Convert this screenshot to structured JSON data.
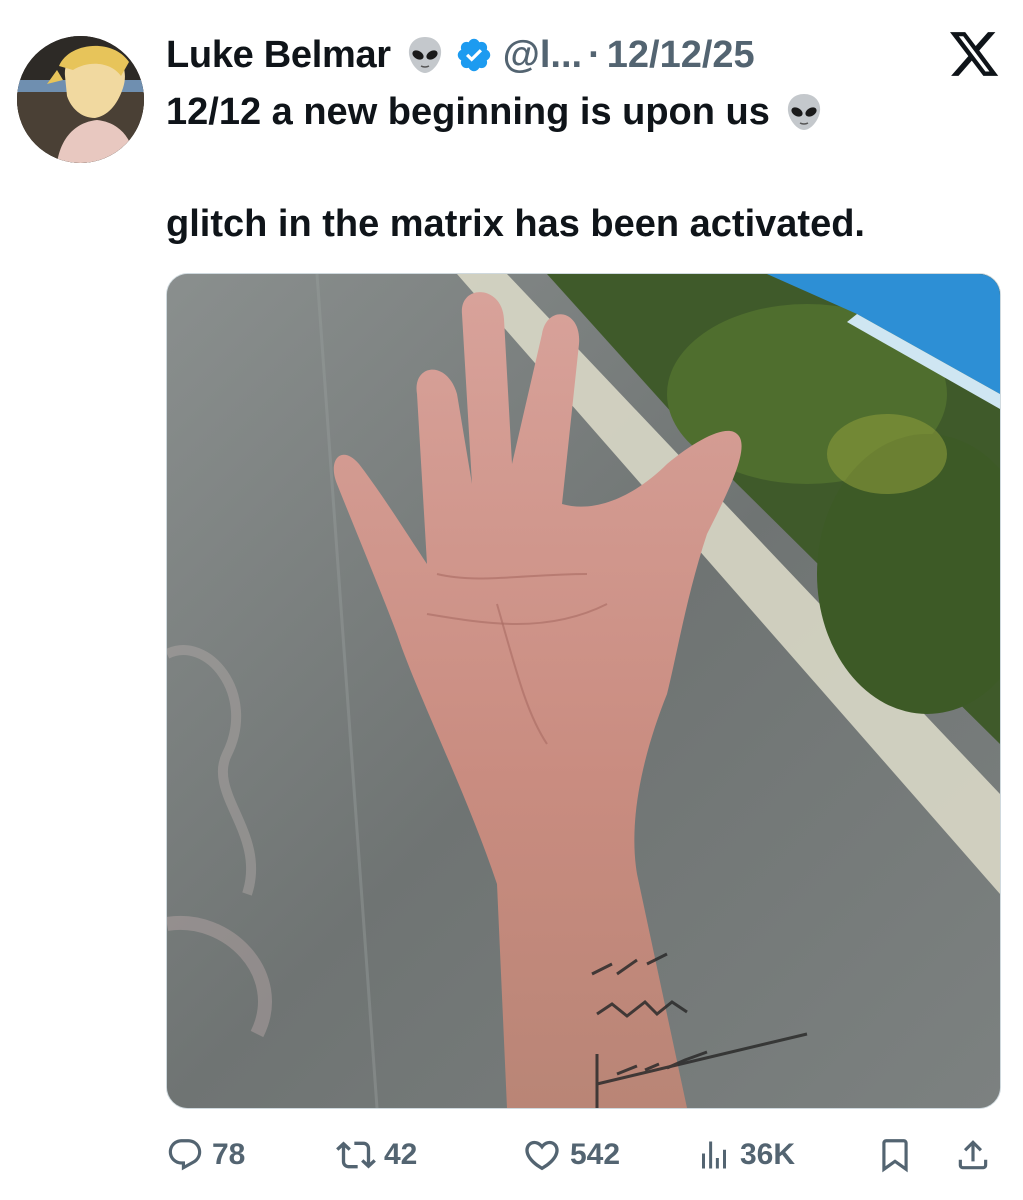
{
  "tweet": {
    "author_name": "Luke Belmar",
    "handle": "@l...",
    "separator": "·",
    "date": "12/12/25",
    "line1": "12/12 a new beginning is upon us",
    "line2": "glitch in the matrix has been activated."
  },
  "metrics": {
    "replies": "78",
    "retweets": "42",
    "likes": "542",
    "views": "36K"
  },
  "colors": {
    "verified_blue": "#1d9bf0",
    "muted_text": "#536471",
    "primary_text": "#0f1419"
  },
  "icons": [
    "alien-emoji-icon",
    "verified-badge-icon",
    "x-logo-icon",
    "reply-icon",
    "retweet-icon",
    "like-icon",
    "views-icon",
    "bookmark-icon",
    "share-icon"
  ]
}
